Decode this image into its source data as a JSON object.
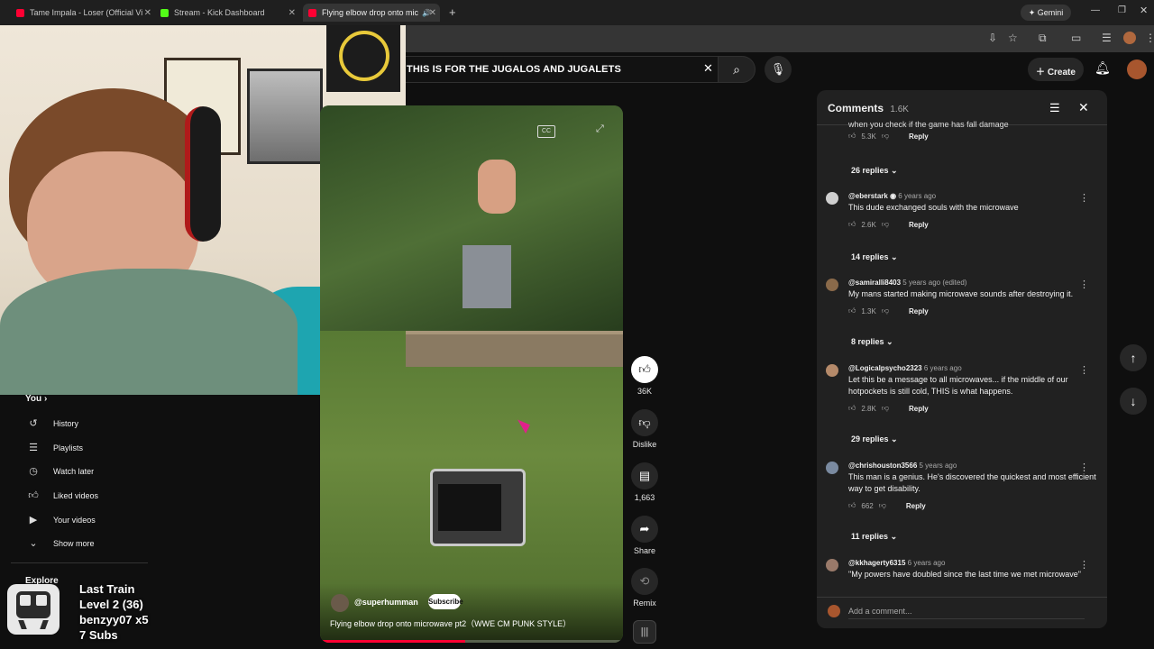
{
  "browser": {
    "tabs": [
      {
        "title": "Tame Impala - Loser (Official Vi",
        "color": "#ff0033"
      },
      {
        "title": "Stream - Kick Dashboard",
        "color": "#53fc18"
      },
      {
        "title": "Flying elbow drop onto mic",
        "color": "#ff0033"
      }
    ],
    "gemini": "Gemini"
  },
  "header": {
    "search_value": "THIS IS FOR THE JUGALOS AND JUGALETS",
    "create": "Create"
  },
  "sidebar": {
    "you": "You",
    "items": [
      "History",
      "Playlists",
      "Watch later",
      "Liked videos",
      "Your videos",
      "Show more"
    ],
    "explore": "Explore"
  },
  "overlay": {
    "title": "Last Train",
    "level": "Level 2  (36)",
    "user": "benzyy07 x5",
    "subs": "7 Subs"
  },
  "short": {
    "channel": "@superhumman",
    "subscribe": "Subscribe",
    "title": "Flying elbow drop onto microwave pt2（WWE CM PUNK STYLE）",
    "progress": 0.48,
    "actions": {
      "likes": "36K",
      "dislike": "Dislike",
      "comments": "1,663",
      "share": "Share",
      "remix": "Remix"
    }
  },
  "comments": {
    "title": "Comments",
    "count": "1.6K",
    "add_placeholder": "Add a comment...",
    "top_partial": {
      "text": "when you check if the game has fall damage",
      "likes": "5.3K",
      "replies": "26 replies"
    },
    "list": [
      {
        "author": "@eberstark",
        "time": "6 years ago",
        "text": "This dude exchanged souls with the microwave",
        "likes": "2.6K",
        "replies": "14 replies",
        "avatar": "#cfcfcf"
      },
      {
        "author": "@samiralli8403",
        "time": "5 years ago (edited)",
        "text": "My mans started making microwave sounds after destroying it.",
        "likes": "1.3K",
        "replies": "8 replies",
        "avatar": "#8a6a4a"
      },
      {
        "author": "@Logicalpsycho2323",
        "time": "6 years ago",
        "text": "Let this be a message to all microwaves... if the middle of our hotpockets is still cold, THIS is what happens.",
        "likes": "2.8K",
        "replies": "29 replies",
        "avatar": "#b58a6a"
      },
      {
        "author": "@chrishouston3566",
        "time": "5 years ago",
        "text": "This man is a genius. He's discovered the quickest and most efficient way to get disability.",
        "likes": "662",
        "replies": "11 replies",
        "avatar": "#7a8aa0"
      },
      {
        "author": "@kkhagerty6315",
        "time": "6 years ago",
        "text": "\"My powers have doubled since the last time we met microwave\"",
        "likes": "",
        "replies": "",
        "avatar": "#9a7a6a"
      }
    ],
    "reply": "Reply"
  }
}
